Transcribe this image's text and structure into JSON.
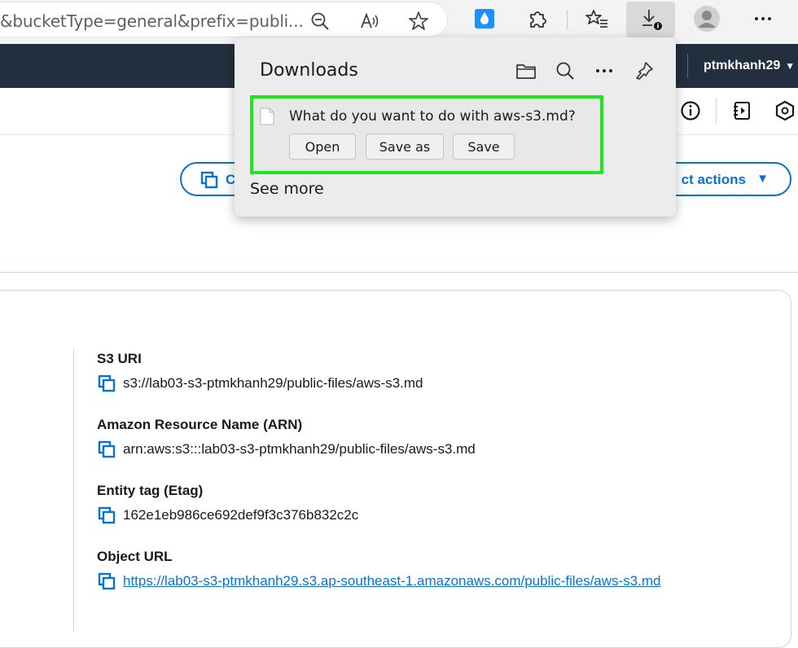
{
  "browser": {
    "address_text": "&bucketType=general&prefix=publi...",
    "icons": [
      "zoom-out-icon",
      "read-aloud-icon",
      "favorite-star-icon",
      "extension-drop-icon",
      "extensions-puzzle-icon",
      "favorites-list-icon",
      "downloads-icon",
      "profile-avatar-icon",
      "more-menu-icon"
    ]
  },
  "aws_header": {
    "username": "ptmkhanh29",
    "caret": "▼"
  },
  "action_buttons": {
    "copy_label": "C",
    "object_actions_label": "ct actions",
    "caret": "▼"
  },
  "downloads": {
    "title": "Downloads",
    "question": "What do you want to do with aws-s3.md?",
    "open_label": "Open",
    "save_as_label": "Save as",
    "save_label": "Save",
    "see_more_label": "See more",
    "highlight_color": "#1ce61c"
  },
  "properties": [
    {
      "label": "S3 URI",
      "value": "s3://lab03-s3-ptmkhanh29/public-files/aws-s3.md",
      "is_link": false
    },
    {
      "label": "Amazon Resource Name (ARN)",
      "value": "arn:aws:s3:::lab03-s3-ptmkhanh29/public-files/aws-s3.md",
      "is_link": false
    },
    {
      "label": "Entity tag (Etag)",
      "value": "162e1eb986ce692def9f3c376b832c2c",
      "is_link": false
    },
    {
      "label": "Object URL",
      "value": "https://lab03-s3-ptmkhanh29.s3.ap-southeast-1.amazonaws.com/public-files/aws-s3.md",
      "is_link": true
    }
  ],
  "colors": {
    "aws_header_bg": "#232f3e",
    "link_blue": "#0972d3"
  }
}
